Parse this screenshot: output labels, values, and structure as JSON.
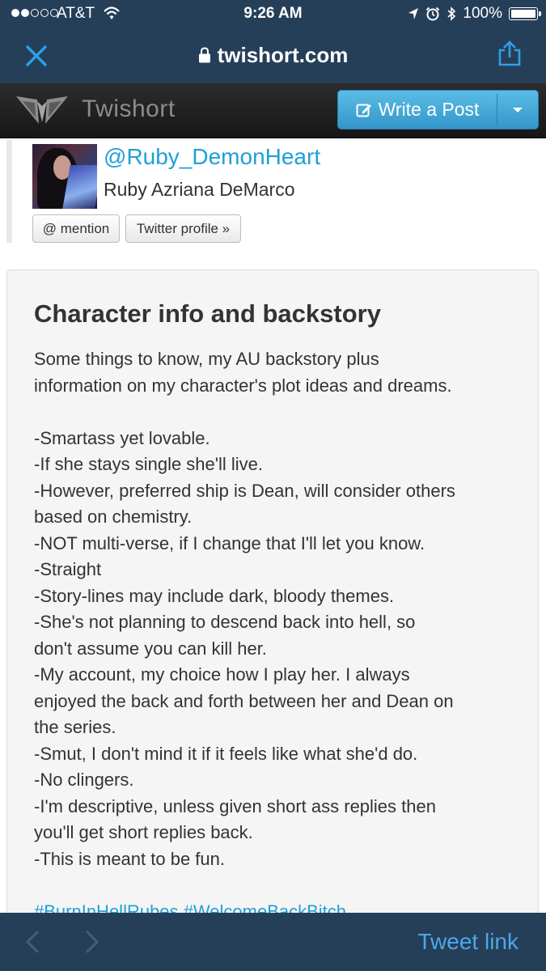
{
  "status_bar": {
    "carrier": "AT&T",
    "time": "9:26 AM",
    "battery": "100%",
    "signal_bars_filled": 2,
    "signal_bars_total": 5,
    "icons": [
      "signal-dots-icon",
      "wifi-icon",
      "location-arrow-icon",
      "alarm-clock-icon",
      "bluetooth-icon",
      "battery-icon"
    ]
  },
  "browser": {
    "url": "twishort.com",
    "icons": [
      "close-icon",
      "lock-icon",
      "share-icon"
    ]
  },
  "site_header": {
    "brand": "Twishort",
    "write_button_label": "Write a Post",
    "icons": [
      "twishort-wings-logo",
      "edit-pencil-icon",
      "caret-down-icon"
    ]
  },
  "profile": {
    "at": "@",
    "handle": "Ruby_DemonHeart",
    "display_name": "Ruby Azriana DeMarco",
    "mention_button": "@ mention",
    "twitter_profile_button": "Twitter profile »"
  },
  "post": {
    "title": "Character info and backstory",
    "intro": [
      "Some things to know, my AU backstory plus",
      "information on my character's plot ideas and dreams."
    ],
    "lines": [
      "-Smartass yet lovable.",
      "-If she stays single she'll live.",
      "-However, preferred ship is Dean, will consider others",
      "based on chemistry.",
      "-NOT multi-verse, if I change that I'll let you know.",
      "-Straight",
      "-Story-lines may include dark, bloody themes.",
      "-She's not planning to descend back into hell, so",
      "don't assume you can kill her.",
      "-My account, my choice how I play her. I always",
      "enjoyed the back and forth between her and Dean on",
      "the series.",
      "-Smut, I don't mind it if it feels like what she'd do.",
      "-No clingers.",
      "-I'm descriptive, unless given short ass replies then",
      "you'll get short replies back.",
      "-This is meant to be fun."
    ],
    "hashtags": [
      "#BurnInHellRubes",
      "#WelcomeBackBitch"
    ]
  },
  "bottom_bar": {
    "tweet_link": "Tweet link",
    "icons": [
      "chevron-left-icon",
      "chevron-right-icon"
    ]
  },
  "colors": {
    "browser_chrome": "#263f59",
    "link_blue": "#1ea0d8",
    "button_blue": "#3fa6d6",
    "header_dark": "#1f1f1f",
    "card_bg": "#f5f5f5"
  }
}
